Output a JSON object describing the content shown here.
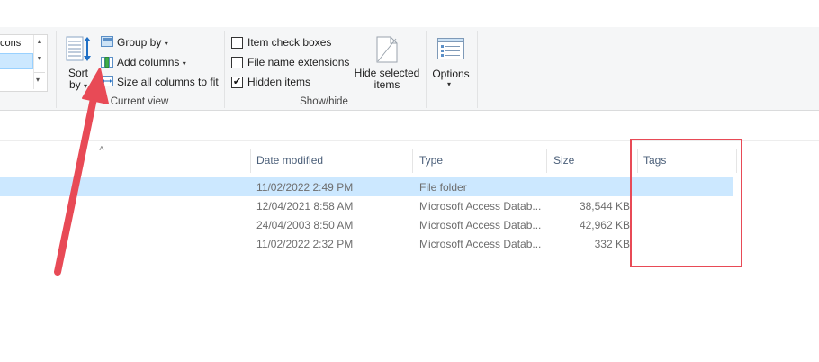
{
  "ribbon": {
    "layout": {
      "visible_item": "cons",
      "scroll_up": "▲",
      "scroll_down": "▼"
    },
    "sort_by": {
      "line1": "Sort",
      "line2": "by",
      "caret": "▾"
    },
    "group_by": {
      "label": "Group by",
      "caret": "▾"
    },
    "add_columns": {
      "label": "Add columns",
      "caret": "▾"
    },
    "size_columns": {
      "label": "Size all columns to fit"
    },
    "current_view_label": "Current view",
    "item_check_boxes": {
      "label": "Item check boxes",
      "checked": false
    },
    "file_name_extensions": {
      "label": "File name extensions",
      "checked": false
    },
    "hidden_items": {
      "label": "Hidden items",
      "checked": true,
      "mark": "✔"
    },
    "hide_selected": {
      "line1": "Hide selected",
      "line2": "items"
    },
    "show_hide_label": "Show/hide",
    "options": {
      "label": "Options",
      "caret": "▾"
    }
  },
  "columns": {
    "sort_indicator": "˄",
    "date_modified": "Date modified",
    "type": "Type",
    "size": "Size",
    "tags": "Tags"
  },
  "rows": [
    {
      "date": "11/02/2022 2:49 PM",
      "type": "File folder",
      "size": "",
      "selected": true
    },
    {
      "date": "12/04/2021 8:58 AM",
      "type": "Microsoft Access Datab...",
      "size": "38,544 KB",
      "selected": false
    },
    {
      "date": "24/04/2003 8:50 AM",
      "type": "Microsoft Access Datab...",
      "size": "42,962 KB",
      "selected": false
    },
    {
      "date": "11/02/2022 2:32 PM",
      "type": "Microsoft Access Datab...",
      "size": "332 KB",
      "selected": false
    }
  ],
  "colors": {
    "annotation_red": "#e84a56",
    "selection_blue": "#cce8ff",
    "column_header_text": "#4c607a"
  }
}
